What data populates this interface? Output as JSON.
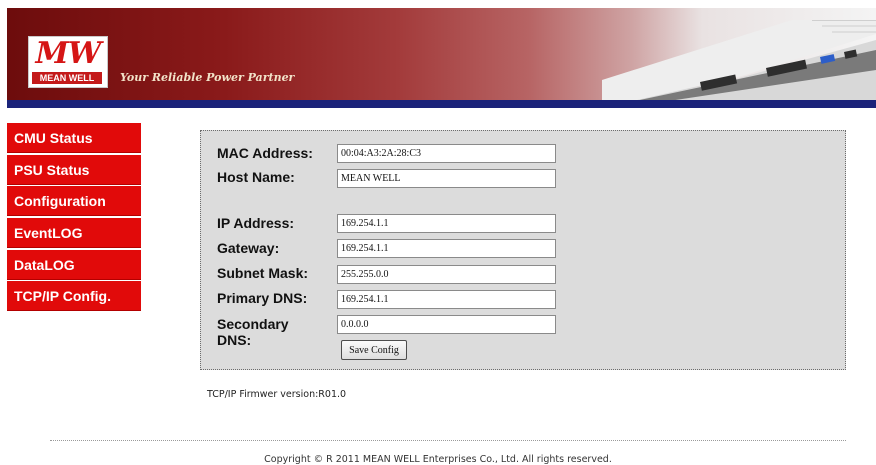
{
  "header": {
    "logo_mark": "MW",
    "logo_name": "MEAN WELL",
    "tagline": "Your Reliable Power Partner"
  },
  "sidebar": {
    "items": [
      {
        "label": "CMU Status"
      },
      {
        "label": "PSU Status"
      },
      {
        "label": "Configuration"
      },
      {
        "label": "EventLOG"
      },
      {
        "label": "DataLOG"
      },
      {
        "label": "TCP/IP Config."
      }
    ]
  },
  "form": {
    "mac_label": "MAC Address:",
    "mac_value": "00:04:A3:2A:28:C3",
    "host_label": "Host Name:",
    "host_value": "MEAN WELL",
    "ip_label": "IP Address:",
    "ip_value": "169.254.1.1",
    "gateway_label": "Gateway:",
    "gateway_value": "169.254.1.1",
    "subnet_label": "Subnet Mask:",
    "subnet_value": "255.255.0.0",
    "pdns_label": "Primary DNS:",
    "pdns_value": "169.254.1.1",
    "sdns_label_line1": "Secondary",
    "sdns_label_line2": "DNS:",
    "sdns_value": "0.0.0.0",
    "save_label": "Save Config"
  },
  "footer": {
    "fw_version": "TCP/IP Firmwer version:R01.0",
    "copyright": "Copyright © R 2011 MEAN WELL Enterprises Co., Ltd. All rights reserved."
  },
  "colors": {
    "nav_red": "#e10a0a",
    "banner_red": "#8a1a1a",
    "banner_stripe": "#1b237a",
    "panel_gray": "#dcdcdc"
  }
}
